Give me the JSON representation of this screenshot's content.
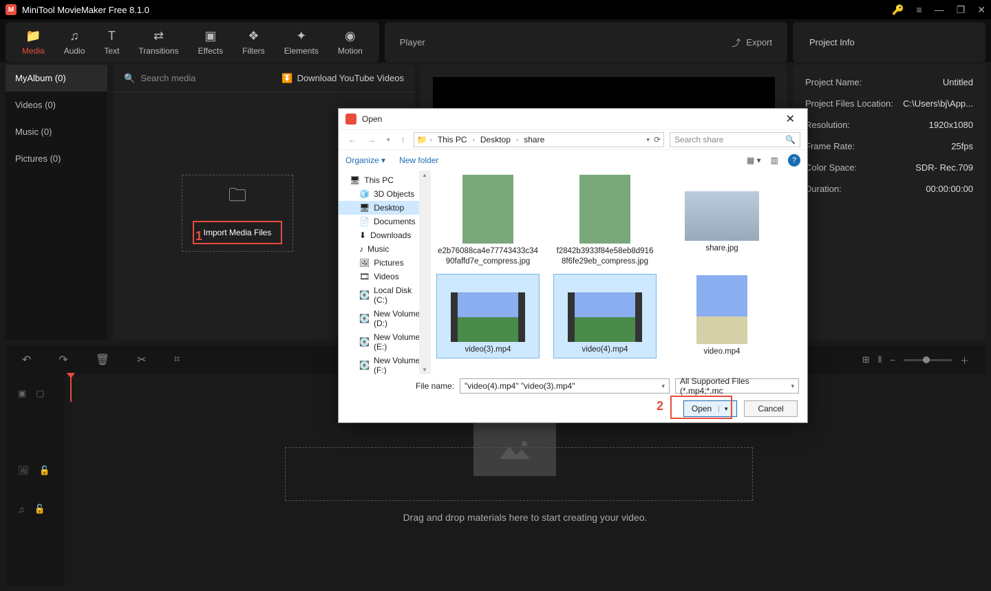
{
  "titlebar": {
    "app_title": "MiniTool MovieMaker Free 8.1.0"
  },
  "tabs": {
    "group1": [
      {
        "icon": "📁",
        "label": "Media",
        "active": true
      },
      {
        "icon": "♫",
        "label": "Audio"
      },
      {
        "icon": "T",
        "label": "Text"
      },
      {
        "icon": "⇄",
        "label": "Transitions"
      },
      {
        "icon": "▣",
        "label": "Effects"
      },
      {
        "icon": "❖",
        "label": "Filters"
      },
      {
        "icon": "✦",
        "label": "Elements"
      },
      {
        "icon": "◉",
        "label": "Motion"
      }
    ]
  },
  "player": {
    "title": "Player",
    "export": "Export"
  },
  "projectinfo": {
    "title": "Project Info",
    "rows": [
      {
        "k": "Project Name:",
        "v": "Untitled"
      },
      {
        "k": "Project Files Location:",
        "v": "C:\\Users\\bj\\App..."
      },
      {
        "k": "Resolution:",
        "v": "1920x1080"
      },
      {
        "k": "Frame Rate:",
        "v": "25fps"
      },
      {
        "k": "Color Space:",
        "v": "SDR- Rec.709"
      },
      {
        "k": "Duration:",
        "v": "00:00:00:00"
      }
    ]
  },
  "sidebar": {
    "items": [
      {
        "label": "MyAlbum (0)",
        "active": true
      },
      {
        "label": "Videos (0)"
      },
      {
        "label": "Music (0)"
      },
      {
        "label": "Pictures (0)"
      }
    ]
  },
  "mediapane": {
    "search_placeholder": "Search media",
    "download": "Download YouTube Videos",
    "import_label": "Import Media Files"
  },
  "annotations": {
    "one": "1",
    "two": "2"
  },
  "timeline": {
    "hint": "Drag and drop materials here to start creating your video."
  },
  "dialog": {
    "title": "Open",
    "breadcrumbs": [
      "This PC",
      "Desktop",
      "share"
    ],
    "search_placeholder": "Search share",
    "organize": "Organize",
    "newfolder": "New folder",
    "tree": [
      {
        "label": "This PC",
        "icon": "🖥",
        "lvl": 0
      },
      {
        "label": "3D Objects",
        "icon": "🧊",
        "lvl": 1
      },
      {
        "label": "Desktop",
        "icon": "🖥",
        "lvl": 1,
        "selected": true
      },
      {
        "label": "Documents",
        "icon": "📄",
        "lvl": 1
      },
      {
        "label": "Downloads",
        "icon": "⬇",
        "lvl": 1
      },
      {
        "label": "Music",
        "icon": "♪",
        "lvl": 1
      },
      {
        "label": "Pictures",
        "icon": "🖼",
        "lvl": 1
      },
      {
        "label": "Videos",
        "icon": "🎞",
        "lvl": 1
      },
      {
        "label": "Local Disk (C:)",
        "icon": "💽",
        "lvl": 1
      },
      {
        "label": "New Volume (D:)",
        "icon": "💽",
        "lvl": 1
      },
      {
        "label": "New Volume (E:)",
        "icon": "💽",
        "lvl": 1
      },
      {
        "label": "New Volume (F:)",
        "icon": "💽",
        "lvl": 1
      }
    ],
    "files": [
      {
        "name": "e2b76088ca4e77743433c3490faffd7e_compress.jpg",
        "kind": "img-tall-flowers"
      },
      {
        "name": "f2842b3933f84e58eb8d9168f6fe29eb_compress.jpg",
        "kind": "img-tall-leaf"
      },
      {
        "name": "share.jpg",
        "kind": "img-wide-plane"
      },
      {
        "name": "video(3).mp4",
        "kind": "video",
        "selected": true
      },
      {
        "name": "video(4).mp4",
        "kind": "video",
        "selected": true
      },
      {
        "name": "video.mp4",
        "kind": "img-tall-grass"
      }
    ],
    "filename_label": "File name:",
    "filename_value": "\"video(4).mp4\" \"video(3).mp4\"",
    "filetype": "All Supported Files (*.mp4;*.mc",
    "open_btn": "Open",
    "cancel_btn": "Cancel"
  }
}
